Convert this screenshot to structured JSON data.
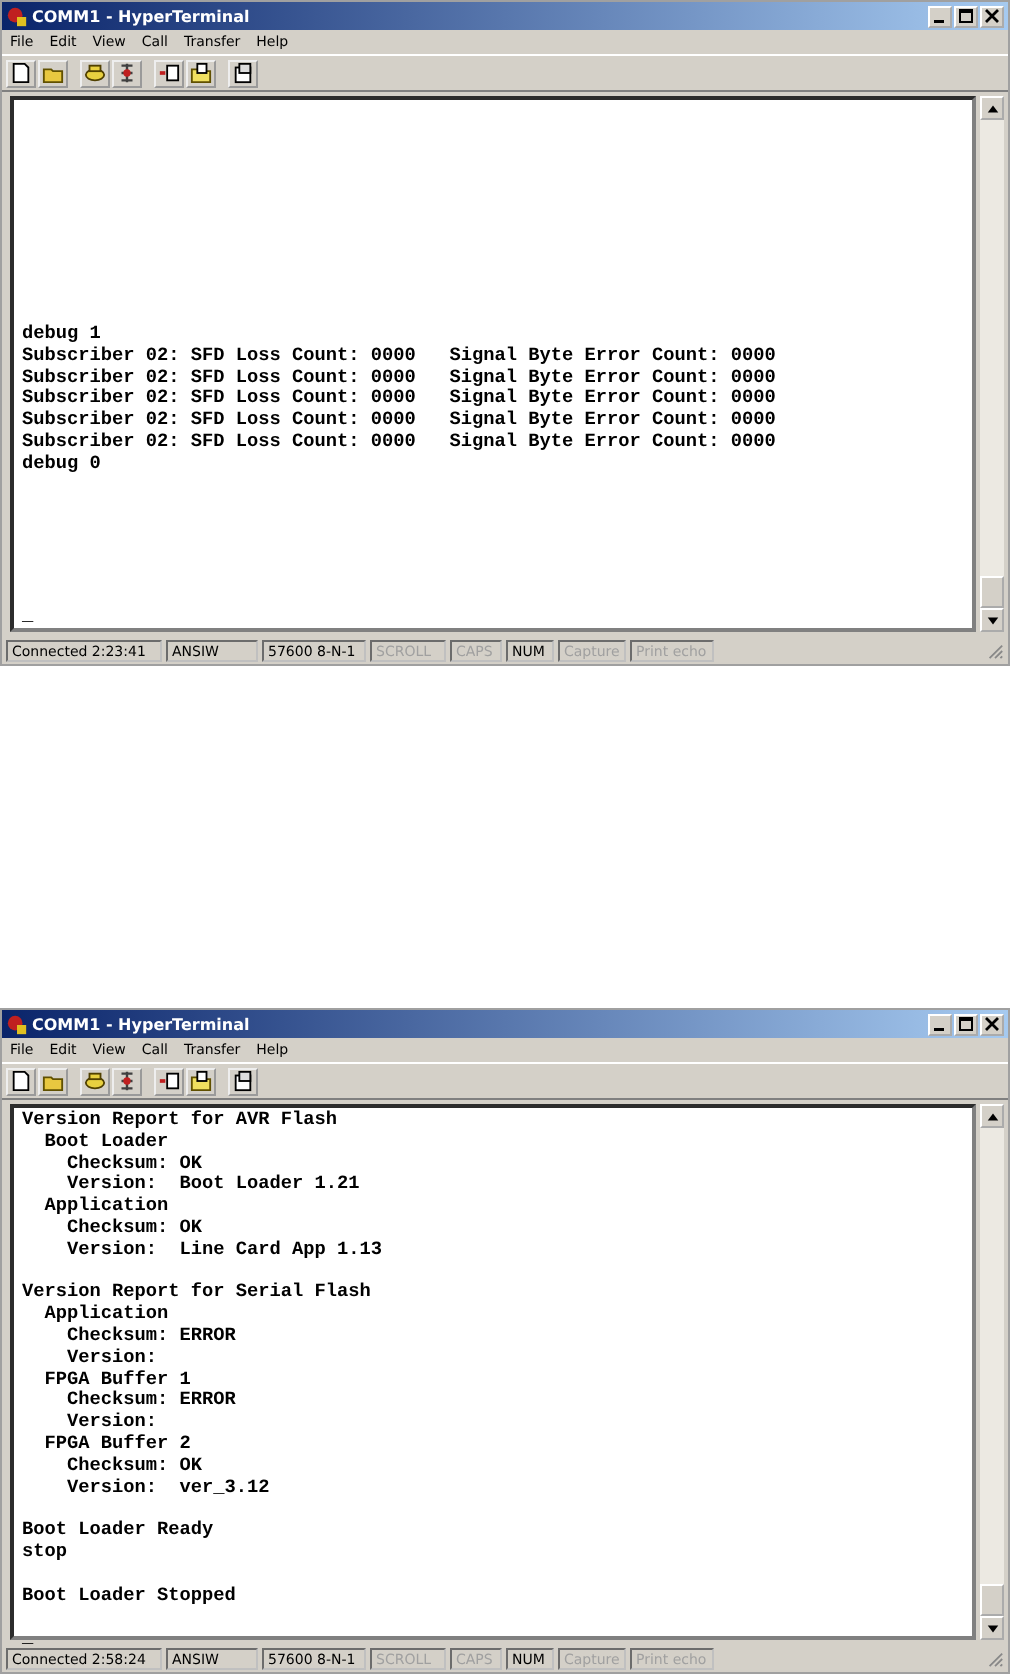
{
  "windows": [
    {
      "title": "COMM1 - HyperTerminal",
      "menu": [
        "File",
        "Edit",
        "View",
        "Call",
        "Transfer",
        "Help"
      ],
      "terminal": {
        "blocks": [
          [
            "debug 1",
            "Subscriber 02: SFD Loss Count: 0000   Signal Byte Error Count: 0000",
            "Subscriber 02: SFD Loss Count: 0000   Signal Byte Error Count: 0000",
            "Subscriber 02: SFD Loss Count: 0000   Signal Byte Error Count: 0000",
            "Subscriber 02: SFD Loss Count: 0000   Signal Byte Error Count: 0000",
            "Subscriber 02: SFD Loss Count: 0000   Signal Byte Error Count: 0000",
            "debug 0"
          ]
        ],
        "cursor": "_"
      },
      "status_bar": [
        {
          "text": "Connected 2:23:41",
          "active": true
        },
        {
          "text": "ANSIW",
          "active": true
        },
        {
          "text": "57600 8-N-1",
          "active": true
        },
        {
          "text": "SCROLL",
          "active": false
        },
        {
          "text": "CAPS",
          "active": false
        },
        {
          "text": "NUM",
          "active": true
        },
        {
          "text": "Capture",
          "active": false
        },
        {
          "text": "Print echo",
          "active": false
        }
      ]
    },
    {
      "title": "COMM1 - HyperTerminal",
      "menu": [
        "File",
        "Edit",
        "View",
        "Call",
        "Transfer",
        "Help"
      ],
      "terminal": {
        "blocks": [
          [
            "Version Report for AVR Flash",
            "  Boot Loader",
            "    Checksum: OK",
            "    Version:  Boot Loader 1.21",
            "  Application",
            "    Checksum: OK",
            "    Version:  Line Card App 1.13"
          ],
          [
            "Version Report for Serial Flash",
            "  Application",
            "    Checksum: ERROR",
            "    Version:",
            "  FPGA Buffer 1",
            "    Checksum: ERROR",
            "    Version:",
            "  FPGA Buffer 2",
            "    Checksum: OK",
            "    Version:  ver_3.12"
          ],
          [
            "Boot Loader Ready",
            "stop"
          ],
          [
            "Boot Loader Stopped"
          ]
        ],
        "cursor": "_"
      },
      "status_bar": [
        {
          "text": "Connected 2:58:24",
          "active": true
        },
        {
          "text": "ANSIW",
          "active": true
        },
        {
          "text": "57600 8-N-1",
          "active": true
        },
        {
          "text": "SCROLL",
          "active": false
        },
        {
          "text": "CAPS",
          "active": false
        },
        {
          "text": "NUM",
          "active": true
        },
        {
          "text": "Capture",
          "active": false
        },
        {
          "text": "Print echo",
          "active": false
        }
      ]
    }
  ]
}
